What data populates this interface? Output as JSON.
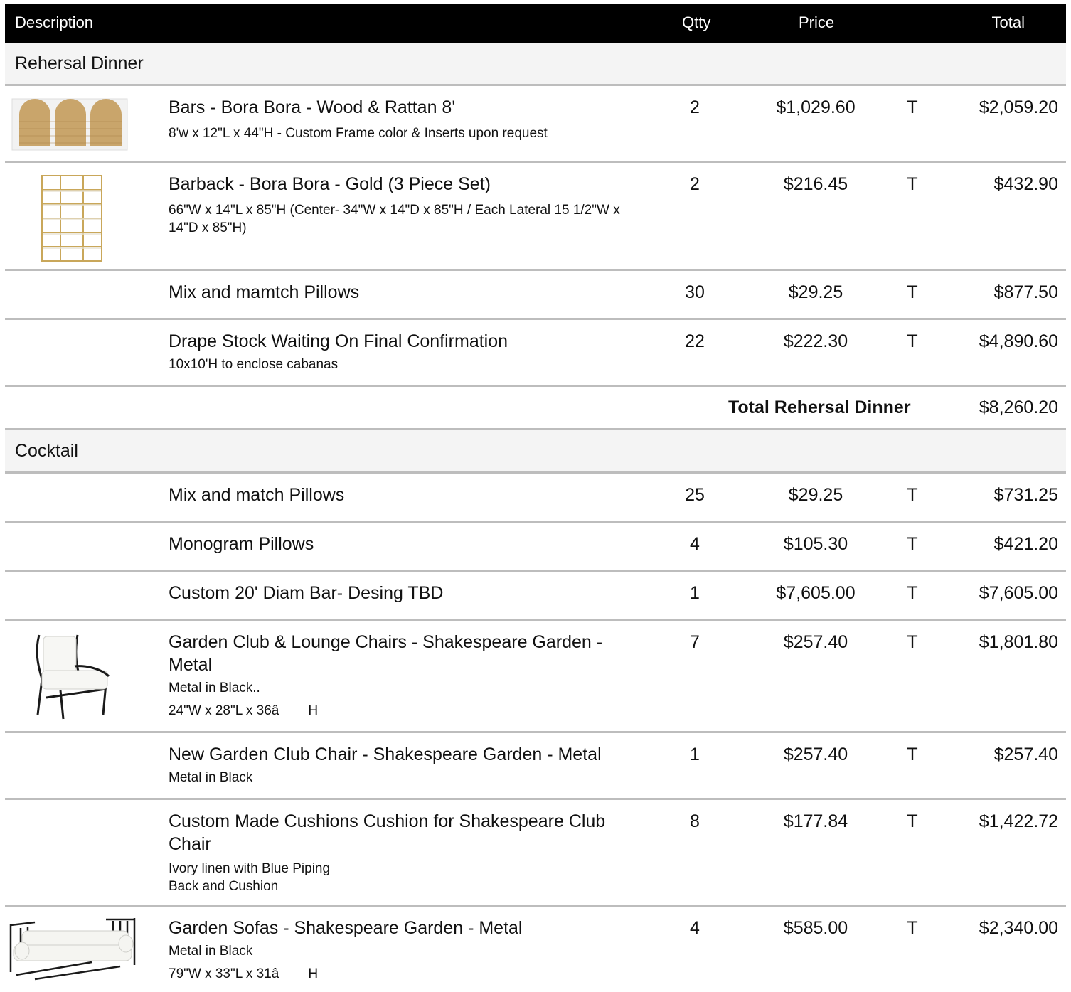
{
  "header": {
    "description": "Description",
    "qty": "Qtty",
    "price": "Price",
    "total": "Total"
  },
  "sections": [
    {
      "title": "Rehersal Dinner",
      "items": [
        {
          "title": "Bars - Bora Bora - Wood & Rattan 8'",
          "sub": "8'w x 12\"L x 44\"H  - Custom Frame color & Inserts upon request",
          "qty": "2",
          "price": "$1,029.60",
          "tax": "T",
          "total": "$2,059.20",
          "image": "rattan-bar-image"
        },
        {
          "title": "Barback - Bora Bora - Gold (3 Piece Set)",
          "sub": "66\"W x 14\"L x 85\"H   (Center- 34\"W x 14\"D x 85\"H / Each Lateral 15 1/2\"W  x 14\"D x 85\"H)",
          "qty": "2",
          "price": "$216.45",
          "tax": "T",
          "total": "$432.90",
          "image": "gold-shelf-image"
        },
        {
          "title": "Mix and mamtch Pillows",
          "qty": "30",
          "price": "$29.25",
          "tax": "T",
          "total": "$877.50"
        },
        {
          "title": "Drape Stock Waiting On Final Confirmation",
          "sub": "10x10'H to enclose cabanas",
          "qty": "22",
          "price": "$222.30",
          "tax": "T",
          "total": "$4,890.60"
        }
      ],
      "subtotal_label": "Total Rehersal Dinner",
      "subtotal_value": "$8,260.20"
    },
    {
      "title": "Cocktail",
      "items": [
        {
          "title": "Mix and match Pillows",
          "qty": "25",
          "price": "$29.25",
          "tax": "T",
          "total": "$731.25"
        },
        {
          "title": "Monogram Pillows",
          "qty": "4",
          "price": "$105.30",
          "tax": "T",
          "total": "$421.20"
        },
        {
          "title": "Custom 20' Diam Bar- Desing TBD",
          "qty": "1",
          "price": "$7,605.00",
          "tax": "T",
          "total": "$7,605.00"
        },
        {
          "title": "Garden Club & Lounge Chairs - Shakespeare Garden - Metal",
          "sub1": "Metal in Black..",
          "sub2": "24\"W x 28\"L x 36â  H",
          "qty": "7",
          "price": "$257.40",
          "tax": "T",
          "total": "$1,801.80",
          "image": "garden-chair-image"
        },
        {
          "title": "New  Garden Club Chair - Shakespeare Garden - Metal",
          "sub": "Metal in Black",
          "qty": "1",
          "price": "$257.40",
          "tax": "T",
          "total": "$257.40"
        },
        {
          "title": "Custom Made Cushions Cushion for Shakespeare  Club Chair",
          "sub1": "Ivory linen with Blue Piping",
          "sub2": "Back and Cushion",
          "qty": "8",
          "price": "$177.84",
          "tax": "T",
          "total": "$1,422.72"
        },
        {
          "title": "Garden Sofas - Shakespeare Garden - Metal",
          "sub1": "Metal in Black",
          "sub2": "79\"W x 33\"L x 31â  H",
          "qty": "4",
          "price": "$585.00",
          "tax": "T",
          "total": "$2,340.00",
          "image": "garden-sofa-image"
        }
      ]
    }
  ]
}
